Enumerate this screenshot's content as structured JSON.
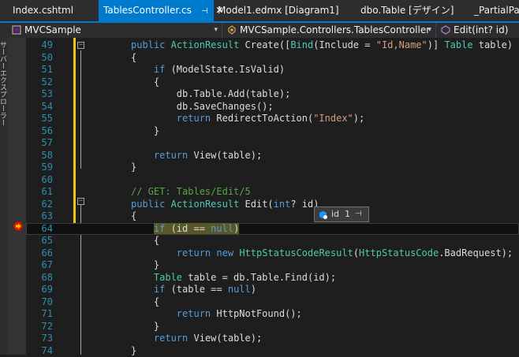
{
  "tabs": [
    {
      "label": "Index.cshtml",
      "active": false
    },
    {
      "label": "TablesController.cs",
      "active": true,
      "pin": "⊣",
      "close": "✕"
    },
    {
      "label": "Model1.edmx [Diagram1]",
      "active": false
    },
    {
      "label": "dbo.Table [デザイン]",
      "active": false
    },
    {
      "label": "_PartialPag",
      "active": false
    }
  ],
  "navbar": {
    "project": "MVCSample",
    "class": "MVCSample.Controllers.TablesController",
    "member": "Edit(int? id)"
  },
  "sidebar_text": "サーバーエクスプローラー",
  "code_lines": [
    {
      "n": "49",
      "html": "<span class=\"kw\">public</span> <span class=\"ty\">ActionResult</span> Create([<span class=\"ty\">Bind</span>(Include = <span class=\"st\">\"Id,Name\"</span>)] <span class=\"ty\">Table</span> table)"
    },
    {
      "n": "50",
      "html": "{"
    },
    {
      "n": "51",
      "html": "    <span class=\"kw\">if</span> (ModelState.IsValid)"
    },
    {
      "n": "52",
      "html": "    {"
    },
    {
      "n": "53",
      "html": "        db.Table.Add(table);"
    },
    {
      "n": "54",
      "html": "        db.SaveChanges();"
    },
    {
      "n": "55",
      "html": "        <span class=\"kw\">return</span> RedirectToAction(<span class=\"st\">\"Index\"</span>);"
    },
    {
      "n": "56",
      "html": "    }"
    },
    {
      "n": "57",
      "html": ""
    },
    {
      "n": "58",
      "html": "    <span class=\"kw\">return</span> View(table);"
    },
    {
      "n": "59",
      "html": "}"
    },
    {
      "n": "60",
      "html": ""
    },
    {
      "n": "61",
      "html": "<span class=\"cm\">// GET: Tables/Edit/5</span>"
    },
    {
      "n": "62",
      "html": "<span class=\"kw\">public</span> <span class=\"ty\">ActionResult</span> Edit(<span class=\"kw\">int</span>? id)"
    },
    {
      "n": "63",
      "html": "{"
    },
    {
      "n": "64",
      "html": "    <span class=\"hl\"><span class=\"kw\">if</span> (id == <span class=\"kw\">null</span>)</span>"
    },
    {
      "n": "65",
      "html": "    {"
    },
    {
      "n": "66",
      "html": "        <span class=\"kw\">return</span> <span class=\"kw\">new</span> <span class=\"ty\">HttpStatusCodeResult</span>(<span class=\"ty\">HttpStatusCode</span>.BadRequest);"
    },
    {
      "n": "67",
      "html": "    }"
    },
    {
      "n": "68",
      "html": "    <span class=\"ty\">Table</span> table = db.Table.Find(id);"
    },
    {
      "n": "69",
      "html": "    <span class=\"kw\">if</span> (table == <span class=\"kw\">null</span>)"
    },
    {
      "n": "70",
      "html": "    {"
    },
    {
      "n": "71",
      "html": "        <span class=\"kw\">return</span> HttpNotFound();"
    },
    {
      "n": "72",
      "html": "    }"
    },
    {
      "n": "73",
      "html": "    <span class=\"kw\">return</span> View(table);"
    },
    {
      "n": "74",
      "html": "}"
    }
  ],
  "tooltip": {
    "name": "id",
    "value": "1",
    "pin": "⊣"
  },
  "colors": {
    "accent": "#007acc",
    "keyword": "#569cd6",
    "type": "#4ec9b0",
    "string": "#d69d85",
    "comment": "#57a64a",
    "line_number": "#2b91af"
  }
}
